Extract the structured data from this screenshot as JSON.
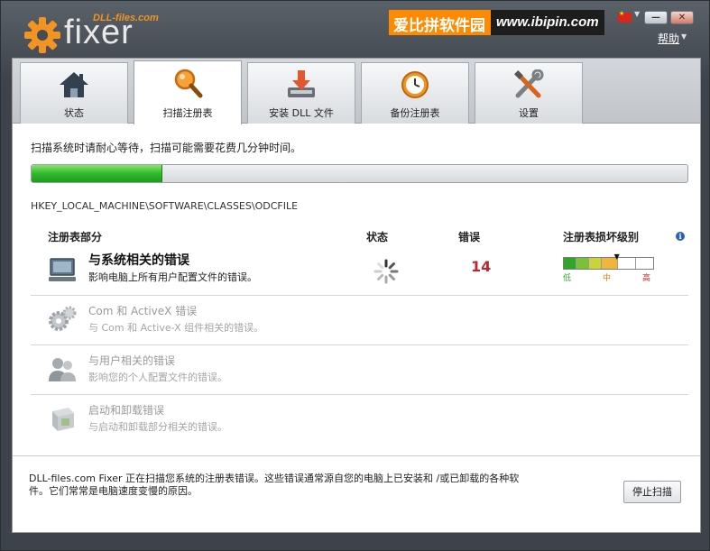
{
  "brand": {
    "site": "DLL-files.com",
    "word": "fixer"
  },
  "watermark": {
    "cn": "爱比拼软件园",
    "url": "www.ibipin.com"
  },
  "titlebar": {
    "min_glyph": "—",
    "close_glyph": "✕",
    "help_label": "帮助"
  },
  "tabs": [
    {
      "label": "状态",
      "icon": "home-icon"
    },
    {
      "label": "扫描注册表",
      "icon": "magnifier-icon"
    },
    {
      "label": "安装 DLL 文件",
      "icon": "download-tray-icon"
    },
    {
      "label": "备份注册表",
      "icon": "clock-icon"
    },
    {
      "label": "设置",
      "icon": "tools-icon"
    }
  ],
  "active_tab": 1,
  "scan": {
    "notice": "扫描系统时请耐心等待，扫描可能需要花费几分钟时间。",
    "progress": 0.2,
    "current_path": "HKEY_LOCAL_MACHINE\\SOFTWARE\\CLASSES\\ODCFILE"
  },
  "table": {
    "headers": {
      "section": "注册表部分",
      "status": "状态",
      "errors": "错误",
      "level": "注册表损坏级别"
    },
    "rows": [
      {
        "title": "与系统相关的错误",
        "desc": "影响电脑上所有用户配置文件的错误。",
        "errors": "14",
        "icon": "system-monitor-icon"
      },
      {
        "title": "Com 和 ActiveX 错误",
        "desc": "与 Com 和 Active-X 组件相关的错误。",
        "icon": "gears-icon"
      },
      {
        "title": "与用户相关的错误",
        "desc": "影响您的个人配置文件的错误。",
        "icon": "users-icon"
      },
      {
        "title": "启动和卸载错误",
        "desc": "与启动和卸载部分相关的错误。",
        "icon": "startup-box-icon"
      }
    ],
    "gauge": {
      "level": 0.6,
      "low": "低",
      "mid": "中",
      "high": "高"
    }
  },
  "footer": {
    "message": "DLL-files.com Fixer 正在扫描您系统的注册表错误。这些错误通常源自您的电脑上已安装和 /或已卸载的各种软件。它们常常是电脑速度变慢的原因。",
    "stop_label": "停止扫描"
  },
  "colors": {
    "accent_orange": "#f39321",
    "error_red": "#c0252a",
    "progress_green": "#2fb92b"
  }
}
